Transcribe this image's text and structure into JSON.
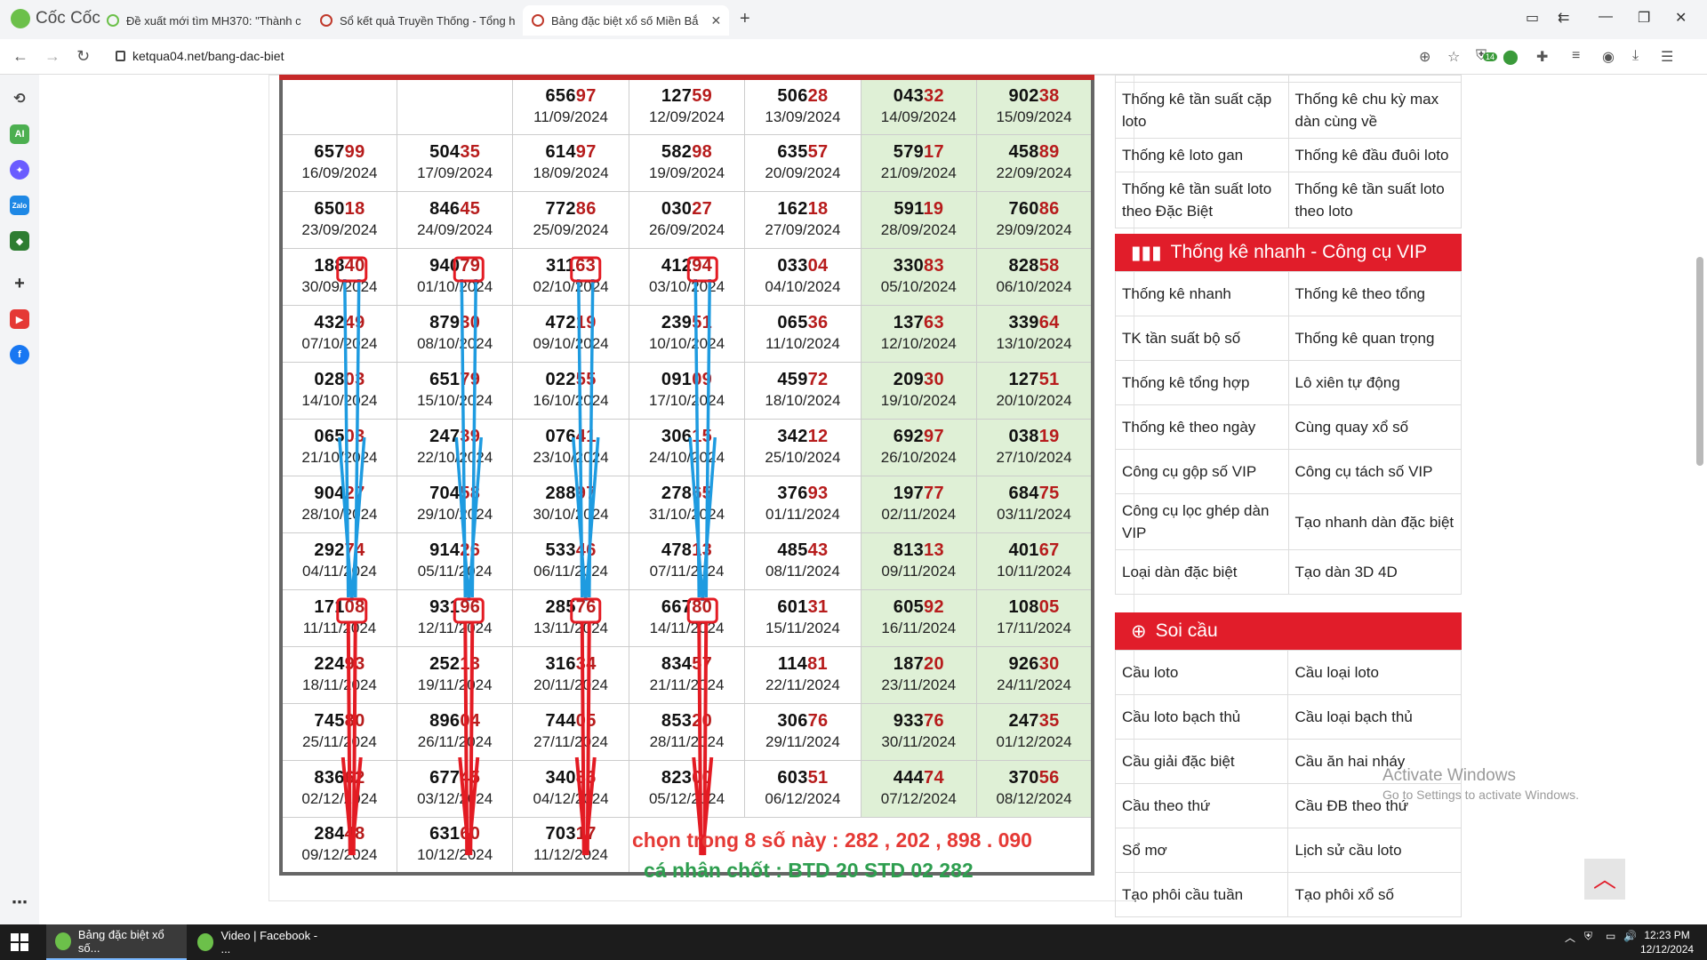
{
  "browser": {
    "brand": "Cốc Cốc",
    "tabs": [
      {
        "title": "Đề xuất mới tìm MH370: \"Thành c",
        "active": false
      },
      {
        "title": "Sổ kết quả Truyền Thống - Tổng h",
        "active": false
      },
      {
        "title": "Bảng đặc biệt xổ số Miền Bắ",
        "active": true
      }
    ],
    "url": "ketqua04.net/bang-dac-biet",
    "extension_badge": "14"
  },
  "results": {
    "rows": [
      [
        null,
        null,
        {
          "head": "656",
          "tail": "97",
          "date": "11/09/2024"
        },
        {
          "head": "127",
          "tail": "59",
          "date": "12/09/2024"
        },
        {
          "head": "506",
          "tail": "28",
          "date": "13/09/2024"
        },
        {
          "head": "043",
          "tail": "32",
          "date": "14/09/2024"
        },
        {
          "head": "902",
          "tail": "38",
          "date": "15/09/2024"
        }
      ],
      [
        {
          "head": "657",
          "tail": "99",
          "date": "16/09/2024"
        },
        {
          "head": "504",
          "tail": "35",
          "date": "17/09/2024"
        },
        {
          "head": "614",
          "tail": "97",
          "date": "18/09/2024"
        },
        {
          "head": "582",
          "tail": "98",
          "date": "19/09/2024"
        },
        {
          "head": "635",
          "tail": "57",
          "date": "20/09/2024"
        },
        {
          "head": "579",
          "tail": "17",
          "date": "21/09/2024"
        },
        {
          "head": "458",
          "tail": "89",
          "date": "22/09/2024"
        }
      ],
      [
        {
          "head": "650",
          "tail": "18",
          "date": "23/09/2024"
        },
        {
          "head": "846",
          "tail": "45",
          "date": "24/09/2024"
        },
        {
          "head": "772",
          "tail": "86",
          "date": "25/09/2024"
        },
        {
          "head": "030",
          "tail": "27",
          "date": "26/09/2024"
        },
        {
          "head": "162",
          "tail": "18",
          "date": "27/09/2024"
        },
        {
          "head": "591",
          "tail": "19",
          "date": "28/09/2024"
        },
        {
          "head": "760",
          "tail": "86",
          "date": "29/09/2024"
        }
      ],
      [
        {
          "head": "188",
          "tail": "40",
          "date": "30/09/2024"
        },
        {
          "head": "940",
          "tail": "79",
          "date": "01/10/2024"
        },
        {
          "head": "311",
          "tail": "63",
          "date": "02/10/2024"
        },
        {
          "head": "412",
          "tail": "94",
          "date": "03/10/2024"
        },
        {
          "head": "033",
          "tail": "04",
          "date": "04/10/2024"
        },
        {
          "head": "330",
          "tail": "83",
          "date": "05/10/2024"
        },
        {
          "head": "828",
          "tail": "58",
          "date": "06/10/2024"
        }
      ],
      [
        {
          "head": "432",
          "tail": "49",
          "date": "07/10/2024"
        },
        {
          "head": "879",
          "tail": "30",
          "date": "08/10/2024"
        },
        {
          "head": "472",
          "tail": "19",
          "date": "09/10/2024"
        },
        {
          "head": "239",
          "tail": "51",
          "date": "10/10/2024"
        },
        {
          "head": "065",
          "tail": "36",
          "date": "11/10/2024"
        },
        {
          "head": "137",
          "tail": "63",
          "date": "12/10/2024"
        },
        {
          "head": "339",
          "tail": "64",
          "date": "13/10/2024"
        }
      ],
      [
        {
          "head": "028",
          "tail": "03",
          "date": "14/10/2024"
        },
        {
          "head": "651",
          "tail": "79",
          "date": "15/10/2024"
        },
        {
          "head": "022",
          "tail": "55",
          "date": "16/10/2024"
        },
        {
          "head": "091",
          "tail": "09",
          "date": "17/10/2024"
        },
        {
          "head": "459",
          "tail": "72",
          "date": "18/10/2024"
        },
        {
          "head": "209",
          "tail": "30",
          "date": "19/10/2024"
        },
        {
          "head": "127",
          "tail": "51",
          "date": "20/10/2024"
        }
      ],
      [
        {
          "head": "065",
          "tail": "03",
          "date": "21/10/2024"
        },
        {
          "head": "247",
          "tail": "39",
          "date": "22/10/2024"
        },
        {
          "head": "076",
          "tail": "41",
          "date": "23/10/2024"
        },
        {
          "head": "306",
          "tail": "15",
          "date": "24/10/2024"
        },
        {
          "head": "342",
          "tail": "12",
          "date": "25/10/2024"
        },
        {
          "head": "692",
          "tail": "97",
          "date": "26/10/2024"
        },
        {
          "head": "038",
          "tail": "19",
          "date": "27/10/2024"
        }
      ],
      [
        {
          "head": "904",
          "tail": "27",
          "date": "28/10/2024"
        },
        {
          "head": "704",
          "tail": "58",
          "date": "29/10/2024"
        },
        {
          "head": "288",
          "tail": "97",
          "date": "30/10/2024"
        },
        {
          "head": "278",
          "tail": "65",
          "date": "31/10/2024"
        },
        {
          "head": "376",
          "tail": "93",
          "date": "01/11/2024"
        },
        {
          "head": "197",
          "tail": "77",
          "date": "02/11/2024"
        },
        {
          "head": "684",
          "tail": "75",
          "date": "03/11/2024"
        }
      ],
      [
        {
          "head": "292",
          "tail": "74",
          "date": "04/11/2024"
        },
        {
          "head": "914",
          "tail": "26",
          "date": "05/11/2024"
        },
        {
          "head": "533",
          "tail": "46",
          "date": "06/11/2024"
        },
        {
          "head": "478",
          "tail": "13",
          "date": "07/11/2024"
        },
        {
          "head": "485",
          "tail": "43",
          "date": "08/11/2024"
        },
        {
          "head": "813",
          "tail": "13",
          "date": "09/11/2024"
        },
        {
          "head": "401",
          "tail": "67",
          "date": "10/11/2024"
        }
      ],
      [
        {
          "head": "171",
          "tail": "08",
          "date": "11/11/2024"
        },
        {
          "head": "931",
          "tail": "96",
          "date": "12/11/2024"
        },
        {
          "head": "285",
          "tail": "76",
          "date": "13/11/2024"
        },
        {
          "head": "667",
          "tail": "80",
          "date": "14/11/2024"
        },
        {
          "head": "601",
          "tail": "31",
          "date": "15/11/2024"
        },
        {
          "head": "605",
          "tail": "92",
          "date": "16/11/2024"
        },
        {
          "head": "108",
          "tail": "05",
          "date": "17/11/2024"
        }
      ],
      [
        {
          "head": "224",
          "tail": "93",
          "date": "18/11/2024"
        },
        {
          "head": "252",
          "tail": "13",
          "date": "19/11/2024"
        },
        {
          "head": "316",
          "tail": "34",
          "date": "20/11/2024"
        },
        {
          "head": "834",
          "tail": "57",
          "date": "21/11/2024"
        },
        {
          "head": "114",
          "tail": "81",
          "date": "22/11/2024"
        },
        {
          "head": "187",
          "tail": "20",
          "date": "23/11/2024"
        },
        {
          "head": "926",
          "tail": "30",
          "date": "24/11/2024"
        }
      ],
      [
        {
          "head": "745",
          "tail": "80",
          "date": "25/11/2024"
        },
        {
          "head": "896",
          "tail": "04",
          "date": "26/11/2024"
        },
        {
          "head": "744",
          "tail": "05",
          "date": "27/11/2024"
        },
        {
          "head": "853",
          "tail": "20",
          "date": "28/11/2024"
        },
        {
          "head": "306",
          "tail": "76",
          "date": "29/11/2024"
        },
        {
          "head": "933",
          "tail": "76",
          "date": "30/11/2024"
        },
        {
          "head": "247",
          "tail": "35",
          "date": "01/12/2024"
        }
      ],
      [
        {
          "head": "836",
          "tail": "62",
          "date": "02/12/2024"
        },
        {
          "head": "677",
          "tail": "45",
          "date": "03/12/2024"
        },
        {
          "head": "340",
          "tail": "86",
          "date": "04/12/2024"
        },
        {
          "head": "823",
          "tail": "00",
          "date": "05/12/2024"
        },
        {
          "head": "603",
          "tail": "51",
          "date": "06/12/2024"
        },
        {
          "head": "444",
          "tail": "74",
          "date": "07/12/2024"
        },
        {
          "head": "370",
          "tail": "56",
          "date": "08/12/2024"
        }
      ],
      [
        {
          "head": "284",
          "tail": "48",
          "date": "09/12/2024"
        },
        {
          "head": "631",
          "tail": "60",
          "date": "10/12/2024"
        },
        {
          "head": "703",
          "tail": "17",
          "date": "11/12/2024"
        },
        null,
        null,
        null,
        null
      ]
    ],
    "annotation_line1": "chọn trong 8 số này : 282 , 202 , 898 . 090",
    "annotation_line2": "cá nhân chốt : BTD 20 STD 02 282"
  },
  "right_panel": {
    "stats_rows": [
      [
        "Thống kê tần suất cặp loto",
        "Thống kê chu kỳ max dàn cùng về"
      ],
      [
        "Thống kê loto gan",
        "Thống kê đầu đuôi loto"
      ],
      [
        "Thống kê tần suất loto theo Đặc Biệt",
        "Thống kê tần suất loto theo loto"
      ]
    ],
    "vip_header": "Thống kê nhanh - Công cụ VIP",
    "vip_rows": [
      [
        "Thống kê nhanh",
        "Thống kê theo tổng"
      ],
      [
        "TK tần suất bộ số",
        "Thống kê quan trọng"
      ],
      [
        "Thống kê tổng hợp",
        "Lô xiên tự động"
      ],
      [
        "Thống kê theo ngày",
        "Cùng quay xổ số"
      ],
      [
        "Công cụ gộp số VIP",
        "Công cụ tách số VIP"
      ],
      [
        "Công cụ lọc ghép dàn VIP",
        "Tạo nhanh dàn đặc biệt"
      ],
      [
        "Loại dàn đặc biệt",
        "Tạo dàn 3D 4D"
      ]
    ],
    "soi_header": "Soi cầu",
    "soi_rows": [
      [
        "Cầu loto",
        "Cầu loại loto"
      ],
      [
        "Cầu loto bạch thủ",
        "Cầu loại bạch thủ"
      ],
      [
        "Cầu giải đặc biệt",
        "Cầu ăn hai nháy"
      ],
      [
        "Cầu theo thứ",
        "Cầu ĐB theo thứ"
      ],
      [
        "Sổ mơ",
        "Lịch sử cầu loto"
      ],
      [
        "Tạo phôi cầu tuần",
        "Tạo phôi xổ số"
      ]
    ]
  },
  "watermark": {
    "line1": "Activate Windows",
    "line2": "Go to Settings to activate Windows."
  },
  "taskbar": {
    "items": [
      "Bảng đặc biệt xổ số...",
      "Video | Facebook - ..."
    ],
    "time": "12:23 PM",
    "date": "12/12/2024"
  },
  "colors": {
    "accent_red": "#e11d2a",
    "weekend_green": "#dff0d6",
    "number_tail": "#b71c1c",
    "arrow_blue": "#1e9be0",
    "arrow_red": "#e31b23",
    "note_green": "#2e9e4f"
  }
}
